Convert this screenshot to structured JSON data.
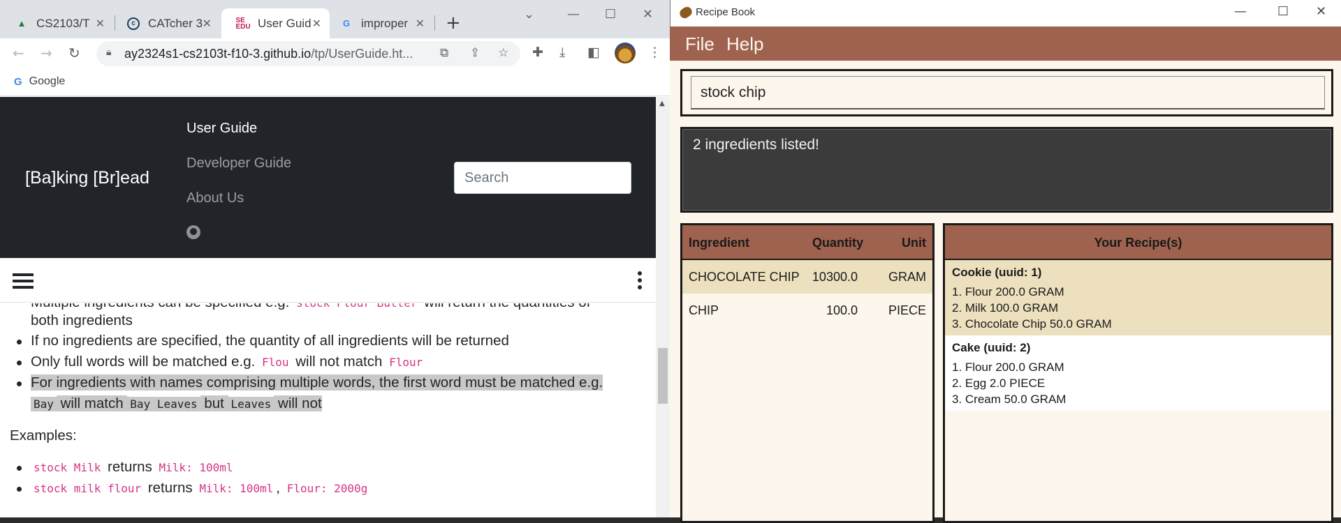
{
  "browser": {
    "tabs": [
      {
        "label": "CS2103/T",
        "icon": "graduation-cap-icon"
      },
      {
        "label": "CATcher 3",
        "icon": "catcher-icon"
      },
      {
        "label": "User Guid",
        "icon": "se-edu-icon"
      },
      {
        "label": "improper",
        "icon": "google-icon"
      }
    ],
    "url_host": "ay2324s1-cs2103t-f10-3.github.io",
    "url_path": "/tp/UserGuide.ht...",
    "bookmark_google": "Google"
  },
  "site": {
    "brand": "[Ba]king [Br]ead",
    "nav": {
      "user_guide": "User Guide",
      "developer_guide": "Developer Guide",
      "about_us": "About Us"
    },
    "search_placeholder": "Search"
  },
  "content": {
    "line1a": "Multiple ingredients can be specified e.g. ",
    "line1code": "stock Flour Butter",
    "line1b": " will return the quantities of",
    "line1cont": "both ingredients",
    "line2": "If no ingredients are specified, the quantity of all ingredients will be returned",
    "line3a": "Only full words will be matched e.g. ",
    "line3code1": "Flou",
    "line3b": " will not match ",
    "line3code2": "Flour",
    "line4": "For ingredients with names comprising multiple words, the first word must be matched e.g.",
    "line4code1": "Bay",
    "line4b": " will match ",
    "line4code2": "Bay Leaves",
    "line4c": " but ",
    "line4code3": "Leaves",
    "line4d": " will not",
    "examples_label": "Examples:",
    "ex1code": "stock Milk",
    "ex1mid": " returns ",
    "ex1res": "Milk: 100ml",
    "ex2code": "stock milk flour",
    "ex2mid": " returns ",
    "ex2res1": "Milk: 100ml",
    "ex2sep": ", ",
    "ex2res2": "Flour: 2000g"
  },
  "app": {
    "title": "Recipe Book",
    "menu": {
      "file": "File",
      "help": "Help"
    },
    "command_value": "stock chip",
    "result": "2 ingredients listed!",
    "ingredient_table": {
      "headers": {
        "name": "Ingredient",
        "quantity": "Quantity",
        "unit": "Unit"
      },
      "rows": [
        {
          "name": "CHOCOLATE CHIP",
          "quantity": "10300.0",
          "unit": "GRAM"
        },
        {
          "name": "CHIP",
          "quantity": "100.0",
          "unit": "PIECE"
        }
      ]
    },
    "recipes_header": "Your Recipe(s)",
    "recipes": [
      {
        "title": "Cookie (uuid: 1)",
        "items": [
          "1. Flour 200.0 GRAM",
          "2. Milk 100.0 GRAM",
          "3. Chocolate Chip 50.0 GRAM"
        ]
      },
      {
        "title": "Cake (uuid: 2)",
        "items": [
          "1. Flour 200.0 GRAM",
          "2. Egg 2.0 PIECE",
          "3. Cream 50.0 GRAM"
        ]
      }
    ]
  },
  "colors": {
    "app_accent": "#9e624e",
    "app_selected_row": "#ede0be",
    "app_background": "#fdf6ec",
    "site_header": "#212529",
    "code_text": "#d63384",
    "highlight": "#c8c8c8"
  }
}
